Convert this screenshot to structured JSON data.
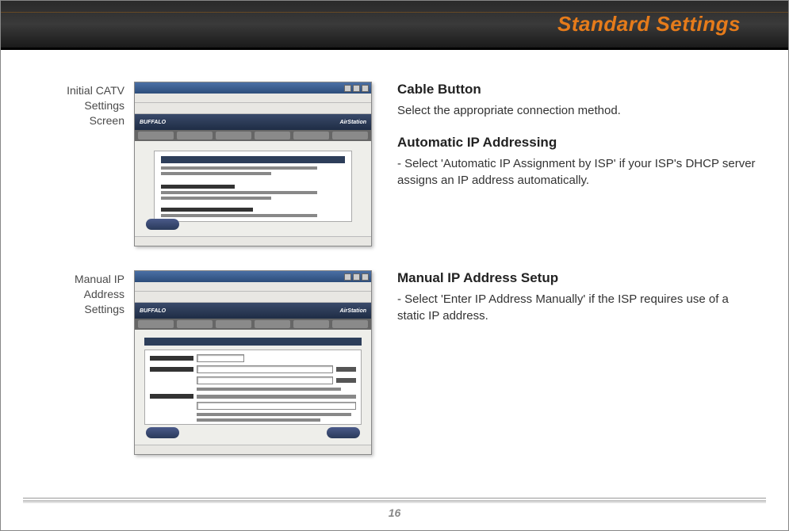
{
  "header": {
    "title": "Standard Settings"
  },
  "figures": {
    "f1": {
      "caption_l1": "Initial CATV",
      "caption_l2": "Settings",
      "caption_l3": "Screen",
      "brand_left": "BUFFALO",
      "brand_right": "AirStation"
    },
    "f2": {
      "caption_l1": "Manual IP",
      "caption_l2": "Address",
      "caption_l3": "Settings",
      "brand_left": "BUFFALO",
      "brand_right": "AirStation"
    }
  },
  "sections": {
    "cable": {
      "heading": "Cable Button",
      "text": "Select the appropriate connection method."
    },
    "auto": {
      "heading": "Automatic IP Addressing",
      "text": "- Select 'Automatic IP Assignment by ISP'  if your ISP's DHCP server assigns an IP address automatically."
    },
    "manual": {
      "heading": "Manual IP Address Setup",
      "text": "- Select 'Enter IP Address Manually' if the ISP requires use of a static IP address."
    }
  },
  "page_number": "16"
}
